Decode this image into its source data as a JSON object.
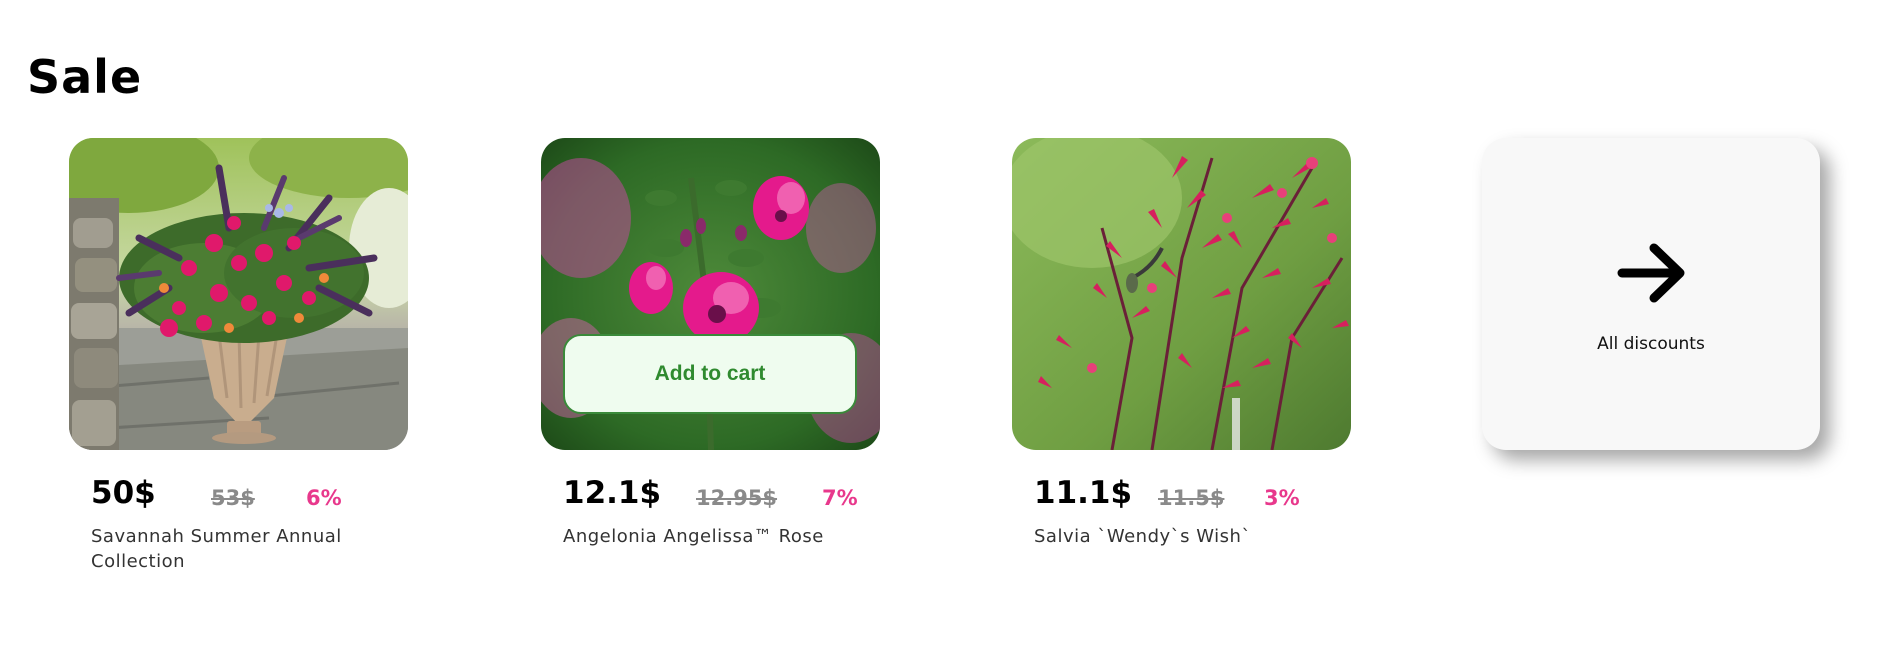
{
  "section": {
    "title": "Sale"
  },
  "products": [
    {
      "price": "50$",
      "old_price": "53$",
      "discount": "6%",
      "name": "Savannah Summer Annual Collection",
      "image": "potted-flower-urn-photo"
    },
    {
      "price": "12.1$",
      "old_price": "12.95$",
      "discount": "7%",
      "name": "Angelonia Angelissa™ Rose",
      "image": "pink-angelonia-photo",
      "add_to_cart_label": "Add to cart"
    },
    {
      "price": "11.1$",
      "old_price": "11.5$",
      "discount": "3%",
      "name": "Salvia `Wendy`s Wish`",
      "image": "red-salvia-photo"
    }
  ],
  "all_discounts": {
    "label": "All discounts",
    "icon": "arrow-right-icon"
  },
  "colors": {
    "discount": "#e8388c",
    "old_price": "#8a8a8a",
    "cart_button_text": "#2f8a2f",
    "cart_button_bg": "#effcef"
  }
}
